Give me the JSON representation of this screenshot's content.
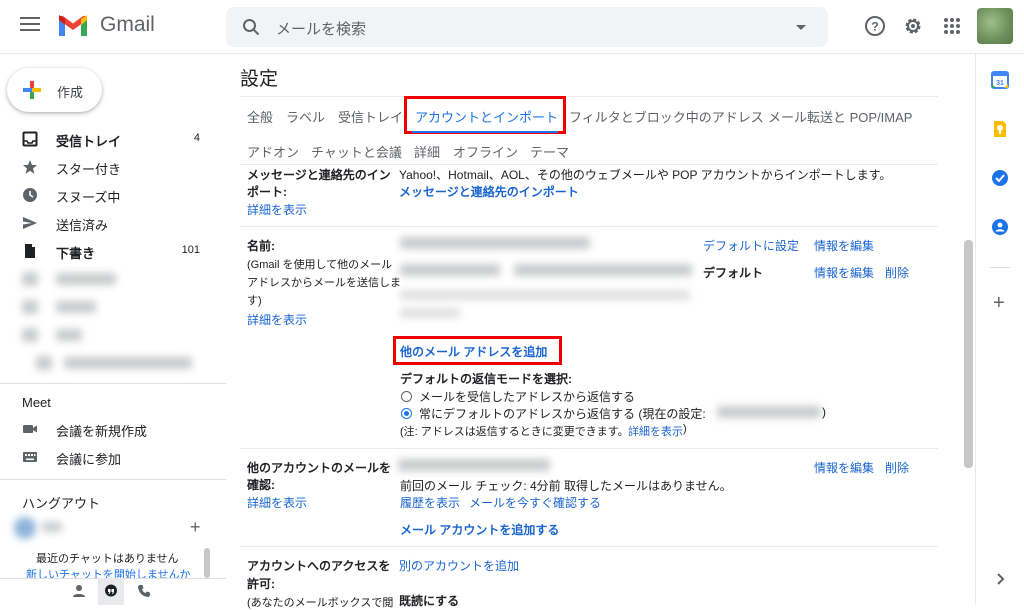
{
  "header": {
    "app_name": "Gmail",
    "search_placeholder": "メールを検索"
  },
  "sidebar": {
    "compose_label": "作成",
    "items": [
      {
        "label": "受信トレイ",
        "count": "4",
        "bold": true
      },
      {
        "label": "スター付き",
        "count": ""
      },
      {
        "label": "スヌーズ中",
        "count": ""
      },
      {
        "label": "送信済み",
        "count": ""
      },
      {
        "label": "下書き",
        "count": "101",
        "bold": true
      }
    ],
    "meet": {
      "title": "Meet",
      "new_meeting": "会議を新規作成",
      "join_meeting": "会議に参加"
    },
    "hangouts": {
      "title": "ハングアウト",
      "no_chats": "最近のチャットはありません",
      "start_chat": "新しいチャットを開始しませんか"
    }
  },
  "settings": {
    "title": "設定",
    "tabs_row1": [
      "全般",
      "ラベル",
      "受信トレイ",
      "アカウントとインポート",
      "フィルタとブロック中のアドレス",
      "メール転送と POP/IMAP"
    ],
    "tabs_row2": [
      "アドオン",
      "チャットと会議",
      "詳細",
      "オフライン",
      "テーマ"
    ],
    "import_section": {
      "label_line1": "メッセージと連絡先のイン",
      "label_line2": "ポート:",
      "details": "詳細を表示",
      "description": "Yahoo!、Hotmail、AOL、その他のウェブメールや POP アカウントからインポートします。",
      "action": "メッセージと連絡先のインポート"
    },
    "name_section": {
      "label": "名前:",
      "sub_line1": "(Gmail を使用して他のメール",
      "sub_line2": "アドレスからメールを送信しま",
      "sub_line3": "す)",
      "details": "詳細を表示",
      "default_set": "デフォルトに設定",
      "edit_info": "情報を編集",
      "default_label": "デフォルト",
      "edit_info2": "情報を編集",
      "delete": "削除",
      "add_address": "他のメール アドレスを追加",
      "reply_mode_title": "デフォルトの返信モードを選択:",
      "reply_option1": "メールを受信したアドレスから返信する",
      "reply_option2": "常にデフォルトのアドレスから返信する (現在の設定:",
      "reply_option2_end": ")",
      "note": "(注: アドレスは返信するときに変更できます。",
      "note_link": "詳細を表示",
      "note_end": ")"
    },
    "check_mail_section": {
      "label_line1": "他のアカウントのメールを",
      "label_line2": "確認:",
      "details": "詳細を表示",
      "edit_info": "情報を編集",
      "delete": "削除",
      "status": "前回のメール チェック: 4分前 取得したメールはありません。",
      "history": "履歴を表示",
      "check_now": "メールを今すぐ確認する",
      "add_account": "メール アカウントを追加する"
    },
    "grant_access_section": {
      "label_line1": "アカウントへのアクセスを",
      "label_line2": "許可:",
      "sub": "(あなたのメールボックスで閲",
      "add_another": "別のアカウントを追加",
      "history_label": "既読にする"
    }
  },
  "colors": {
    "accent": "#1a73e8",
    "highlight": "#e00000",
    "link": "#1a64d0"
  }
}
